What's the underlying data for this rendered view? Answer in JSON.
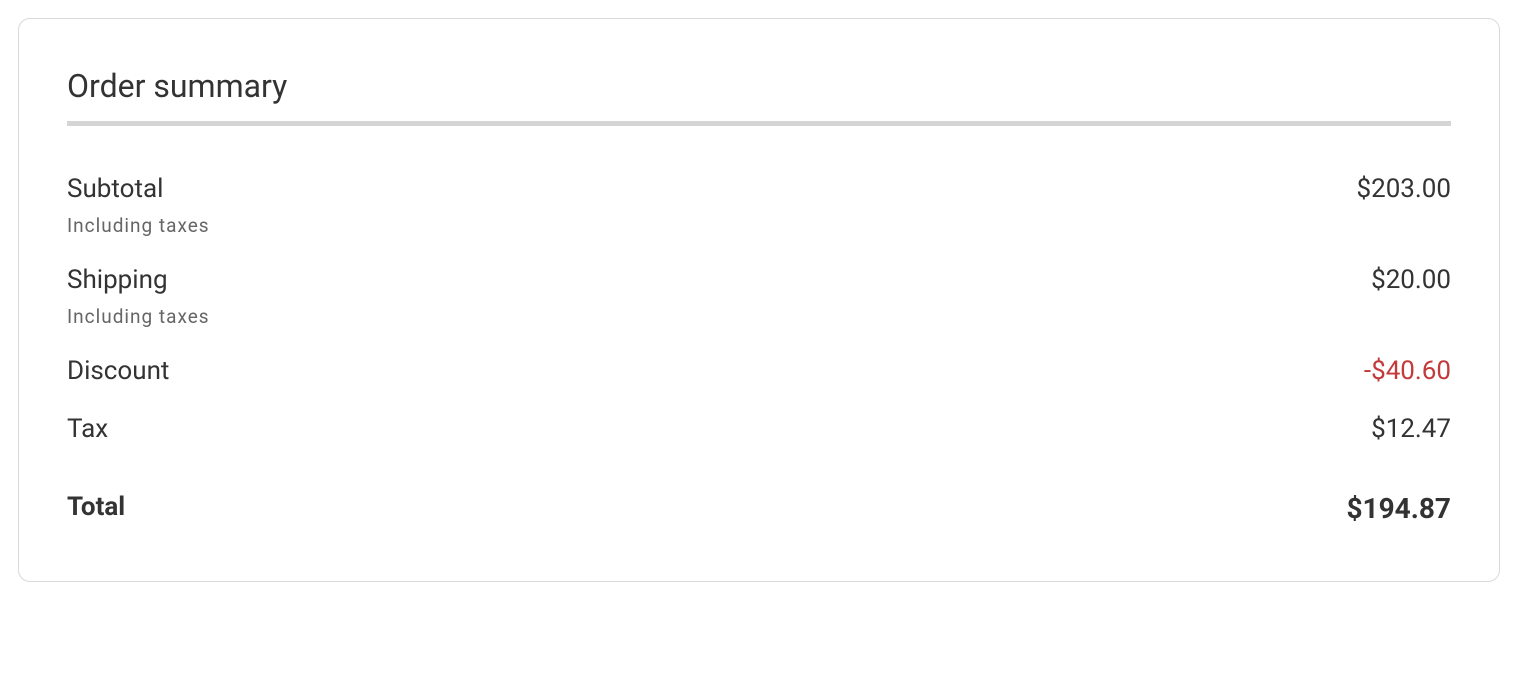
{
  "order_summary": {
    "title": "Order summary",
    "lines": [
      {
        "label": "Subtotal",
        "sublabel": "Including taxes",
        "value": "$203.00",
        "discount": false
      },
      {
        "label": "Shipping",
        "sublabel": "Including taxes",
        "value": "$20.00",
        "discount": false
      },
      {
        "label": "Discount",
        "sublabel": "",
        "value": "-$40.60",
        "discount": true
      },
      {
        "label": "Tax",
        "sublabel": "",
        "value": "$12.47",
        "discount": false
      }
    ],
    "total": {
      "label": "Total",
      "value": "$194.87"
    }
  }
}
